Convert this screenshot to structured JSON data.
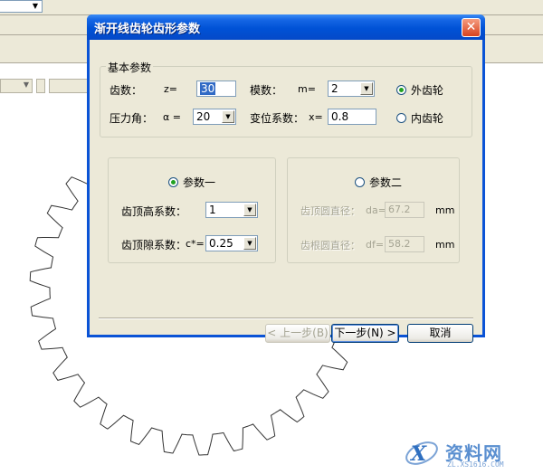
{
  "background_app": {
    "combo_arrow": "▼",
    "field_arrow": "▼"
  },
  "dialog": {
    "title": "渐开线齿轮齿形参数",
    "close_symbol": "✕",
    "basic": {
      "legend": "基本参数",
      "teeth_label": "齿数：",
      "teeth_symbol": "z=",
      "teeth_value": "30",
      "module_label": "模数：",
      "module_symbol": "m=",
      "module_value": "2",
      "external_gear": "外齿轮",
      "pressure_angle_label": "压力角：",
      "pressure_angle_symbol": "α =",
      "pressure_angle_value": "20",
      "shift_label": "变位系数：",
      "shift_symbol": "x=",
      "shift_value": "0.8",
      "internal_gear": "内齿轮"
    },
    "param1": {
      "radio_label": "参数一",
      "addendum_label": "齿顶高系数：",
      "addendum_value": "1",
      "clearance_label": "齿顶隙系数：",
      "clearance_symbol": "c*=",
      "clearance_value": "0.25"
    },
    "param2": {
      "radio_label": "参数二",
      "tip_label": "齿顶圆直径：",
      "tip_symbol": "da=",
      "tip_value": "67.2",
      "tip_unit": "mm",
      "root_label": "齿根圆直径：",
      "root_symbol": "df=",
      "root_value": "58.2",
      "root_unit": "mm"
    },
    "buttons": {
      "prev": "< 上一步(B)",
      "next": "下一步(N) >",
      "cancel": "取消"
    },
    "combo_arrow": "▼"
  },
  "watermark": {
    "name": "资料网",
    "url": "ZL.XS1616.COM"
  },
  "colors": {
    "titlebar": "#0052d6",
    "dialog_face": "#ece9d8",
    "close_button": "#d8431f",
    "selection": "#316ac5",
    "radio_dot": "#21a121",
    "watermark": "#5a8fd0"
  }
}
